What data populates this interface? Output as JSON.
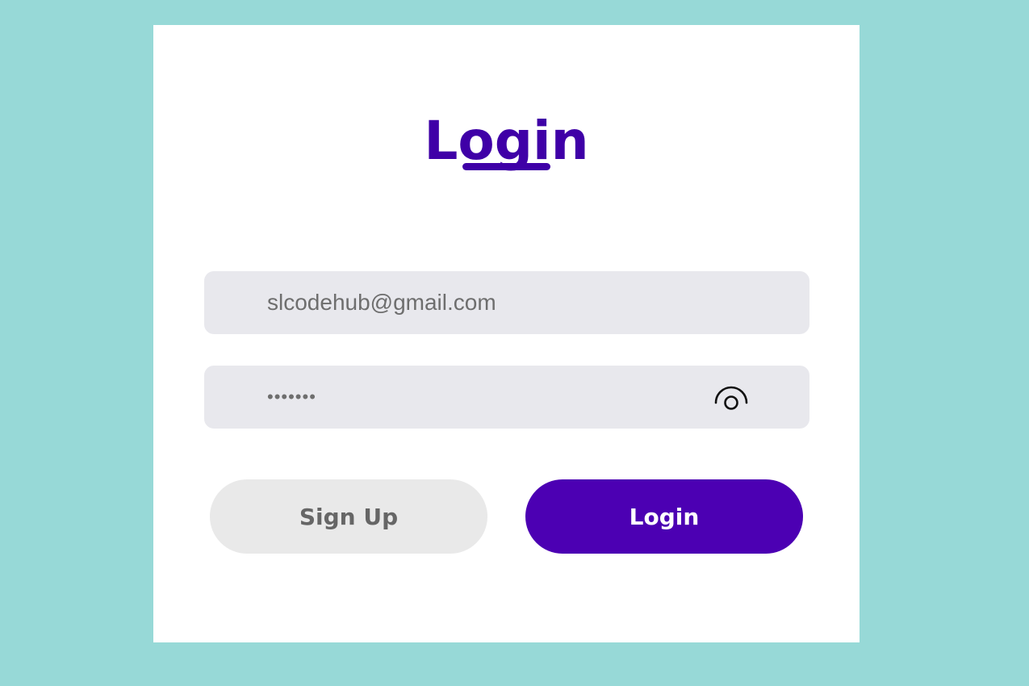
{
  "login_form": {
    "title": "Login",
    "email": {
      "value": "slcodehub@gmail.com",
      "placeholder": ""
    },
    "password": {
      "masked_value": "•••••••",
      "toggle_icon": "eye-icon"
    },
    "buttons": {
      "signup_label": "Sign Up",
      "login_label": "Login"
    }
  },
  "colors": {
    "background": "#97d9d7",
    "card": "#ffffff",
    "accent": "#3f00a7",
    "primary_button": "#4c00b3",
    "secondary_button": "#e9e9e9",
    "input_background": "#e8e8ed"
  }
}
